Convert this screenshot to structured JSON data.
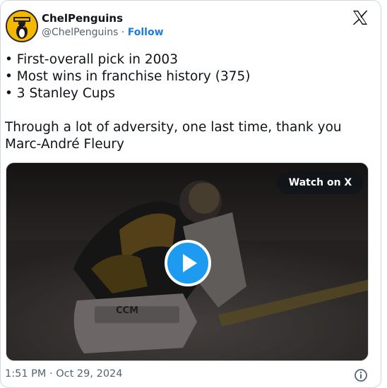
{
  "header": {
    "display_name": "ChelPenguins",
    "handle": "@ChelPenguins",
    "separator": "·",
    "follow_label": "Follow"
  },
  "tweet": {
    "lines": [
      "• First-overall pick in 2003",
      "• Most wins in franchise history (375)",
      "• 3 Stanley Cups",
      "Through a lot of adversity, one last time, thank you",
      "Marc-André Fleury"
    ]
  },
  "media": {
    "watch_label": "Watch on X",
    "play_icon": "play-icon",
    "pad_brand_text": "CCM"
  },
  "footer": {
    "timestamp": "1:51 PM · Oct 29, 2024",
    "info_icon": "info-icon"
  },
  "icons": {
    "brand_logo": "x-logo-icon",
    "avatar": "avatar"
  },
  "colors": {
    "follow": "#1d7ddf",
    "play_button": "#1d9bf0",
    "secondary_text": "#536471",
    "border": "#cfd9de"
  }
}
